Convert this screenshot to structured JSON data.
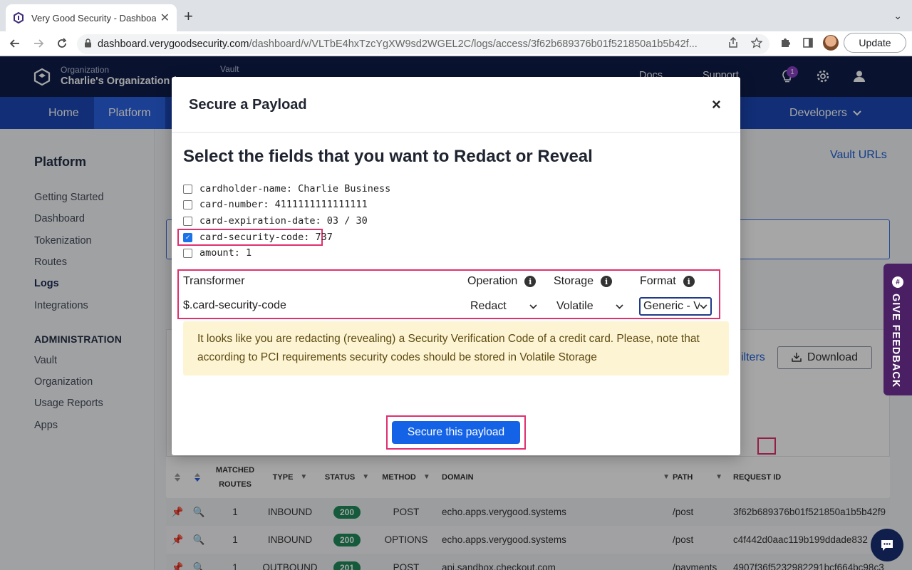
{
  "browser": {
    "tab_title": "Very Good Security - Dashboard",
    "tab_close": "✕",
    "new_tab": "+",
    "tab_menu": "⌄",
    "url_host": "dashboard.verygoodsecurity.com",
    "url_path": "/dashboard/v/VLTbE4hxTzcYgXW9sd2WGEL2C/logs/access/3f62b689376b01f521850a1b5b42f...",
    "update_label": "Update"
  },
  "header": {
    "org_label": "Organization",
    "org_name": "Charlie's Organization (V",
    "vault_label": "Vault",
    "docs": "Docs",
    "support": "Support",
    "notifications_count": "1"
  },
  "nav": {
    "items": [
      "Home",
      "Platform"
    ],
    "developers": "Developers"
  },
  "sidebar": {
    "title": "Platform",
    "items": [
      "Getting Started",
      "Dashboard",
      "Tokenization",
      "Routes",
      "Logs",
      "Integrations"
    ],
    "admin_title": "ADMINISTRATION",
    "admin_items": [
      "Vault",
      "Organization",
      "Usage Reports",
      "Apps"
    ]
  },
  "main": {
    "vault_urls": "Vault URLs",
    "filters": "ilters",
    "download": "Download"
  },
  "table": {
    "headers": {
      "matched_routes_1": "MATCHED",
      "matched_routes_2": "ROUTES",
      "type": "TYPE",
      "status": "STATUS",
      "method": "METHOD",
      "domain": "DOMAIN",
      "path": "PATH",
      "request_id": "REQUEST ID"
    },
    "rows": [
      {
        "routes": "1",
        "type": "INBOUND",
        "status": "200",
        "method": "POST",
        "domain": "echo.apps.verygood.systems",
        "path": "/post",
        "request_id": "3f62b689376b01f521850a1b5b42f9"
      },
      {
        "routes": "1",
        "type": "INBOUND",
        "status": "200",
        "method": "OPTIONS",
        "domain": "echo.apps.verygood.systems",
        "path": "/post",
        "request_id": "c4f442d0aac119b199ddade832"
      },
      {
        "routes": "1",
        "type": "OUTBOUND",
        "status": "201",
        "method": "POST",
        "domain": "api.sandbox.checkout.com",
        "path": "/payments",
        "request_id": "4907f36f5232982291bcf664bc98c3"
      }
    ]
  },
  "feedback": {
    "label": "GIVE FEEDBACK"
  },
  "modal": {
    "title": "Secure a Payload",
    "close": "×",
    "heading": "Select the fields that you want to Redact or Reveal",
    "fields": [
      {
        "label": "cardholder-name: Charlie Business",
        "checked": false
      },
      {
        "label": "card-number: 4111111111111111",
        "checked": false
      },
      {
        "label": "card-expiration-date: 03 / 30",
        "checked": false
      },
      {
        "label": "card-security-code: 737",
        "checked": true
      },
      {
        "label": "amount: 1",
        "checked": false
      }
    ],
    "transformer": {
      "col_transformer": "Transformer",
      "col_operation": "Operation",
      "col_storage": "Storage",
      "col_format": "Format",
      "path": "$.card-security-code",
      "operation": "Redact",
      "storage": "Volatile",
      "format": "Generic - V"
    },
    "warning": "It looks like you are redacting (revealing) a Security Verification Code of a credit card. Please, note that according to PCI requirements security codes should be stored in Volatile Storage",
    "secure_button": "Secure this payload"
  },
  "colors": {
    "header_bg": "#0f1e4a",
    "nav_bg": "#1b48b6",
    "primary_button": "#1463e6",
    "highlight": "#e0306f",
    "status_ok": "#1f8a5b",
    "feedback_bg": "#4a1f64"
  }
}
